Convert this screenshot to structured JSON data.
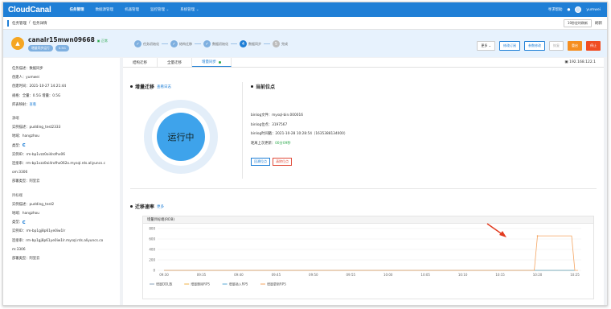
{
  "app": {
    "logo": "CloudCanal",
    "nav": [
      "任务管理",
      "数据源管理",
      "机器管理",
      "监控管理 ⌄",
      "系统管理 ⌄"
    ],
    "help": "寻求帮助",
    "user": "yumwei"
  },
  "breadcrumb": {
    "items": [
      "任务管理",
      "任务详情"
    ],
    "refresh": "10秒定时刷新",
    "refresh_btn": "刷新"
  },
  "task": {
    "name": "canalr15mwn09668",
    "status": "正常",
    "tags": [
      "增量同步运行",
      "0.5G"
    ],
    "steps": [
      {
        "label": "任务初始化",
        "state": "done"
      },
      {
        "label": "结构迁移",
        "state": "done"
      },
      {
        "label": "数据初始化",
        "state": "done"
      },
      {
        "label": "数据同步",
        "state": "current",
        "num": "4"
      },
      {
        "label": "完成",
        "state": "todo",
        "num": "5"
      }
    ],
    "buttons": {
      "more": "更多 ⌄",
      "modify_sub": "修改订阅",
      "param_modify": "参数修改",
      "resume": "恢复",
      "restart": "重启",
      "stop": "停止"
    }
  },
  "left": {
    "task_desc": "任务描述：数据同步",
    "creator": "创建人：yumwei",
    "created": "创建时间：2021-10-27 14:21:44",
    "spec": "规格：全量：0.5G 增量：0.5G",
    "check": "库表映射：",
    "check_link": "查看",
    "source": {
      "title": "源端",
      "instance": "实例描述：pudding_test2333",
      "region": "地域：hangzhou",
      "type": "类型：",
      "id": "实例ID：rm-bp1vzz0oi4rofhx06",
      "conn": "连接串：rm-bp1vzz0oi4rofhx062o.mysql.rds.aliyuncs.c",
      "conn2": "om:3306",
      "deploy": "部署类型：阿里云"
    },
    "target": {
      "title": "目标端",
      "instance": "实例描述：pudding_test2",
      "region": "地域：hangzhou",
      "type": "类型：",
      "id": "实例ID：rm-bp1gj8p61ye0iw1lr",
      "conn": "连接串：rm-bp1gj8p61ye0iw1lr.mysql.rds.aliyuncs.co",
      "conn2": "m:3306",
      "deploy": "部署类型：阿里云"
    }
  },
  "main": {
    "tabs": [
      "结构迁移",
      "全量迁移",
      "增量同步"
    ],
    "ip": "192.168.122.1",
    "incr_title": "增量迁移",
    "view_log": "查看日志",
    "running": "运行中",
    "pos_title": "当前位点",
    "binlog_file": "binlog文件：mysql-bin.000016",
    "binlog_pos": "binlog位点：3197567",
    "binlog_time": "binlog时间戳：2021-10-28 10:28:54（1635388134000）",
    "last_update": "距离上次更新：",
    "last_update_val": "00分09秒",
    "reset_btn": "回溯位点",
    "clear_btn": "清除位点",
    "rate_title": "迁移速率",
    "rate_more": "更多"
  },
  "colors": {
    "accent": "#1f7fd6",
    "running": "#3ea3eb",
    "spike": "#f4a460"
  },
  "chart_data": {
    "type": "line",
    "title": "增量目标端(RDB)",
    "ylim": [
      0,
      800
    ],
    "yticks": [
      0,
      200,
      400,
      600,
      800
    ],
    "x": [
      "09:30",
      "09:35",
      "09:40",
      "09:45",
      "09:50",
      "09:55",
      "10:00",
      "10:05",
      "10:10",
      "10:15",
      "10:20",
      "10:25"
    ],
    "series": [
      {
        "name": "增量DDL数",
        "values": [
          0,
          0,
          0,
          0,
          0,
          0,
          0,
          0,
          0,
          0,
          0,
          0
        ],
        "color": "#8aa0b8"
      },
      {
        "name": "增量删除RPS",
        "values": [
          0,
          0,
          0,
          0,
          0,
          0,
          0,
          0,
          0,
          0,
          0,
          0
        ],
        "color": "#f2b34a"
      },
      {
        "name": "增量插入RPS",
        "values": [
          0,
          0,
          0,
          0,
          0,
          0,
          0,
          0,
          0,
          0,
          0,
          0
        ],
        "color": "#5aa9d6"
      },
      {
        "name": "增量更新RPS",
        "values": [
          0,
          0,
          0,
          0,
          0,
          0,
          0,
          0,
          0,
          0,
          660,
          0
        ],
        "color": "#f4a460"
      }
    ]
  }
}
